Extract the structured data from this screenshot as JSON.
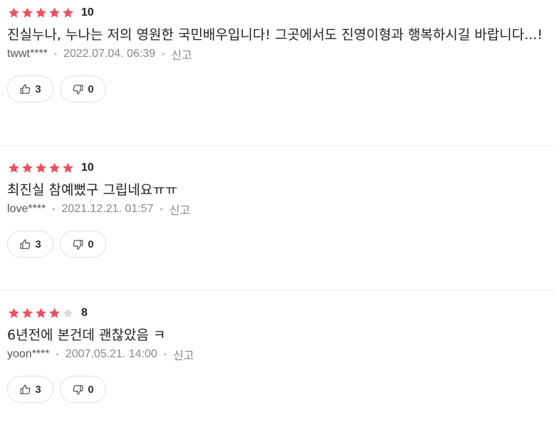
{
  "colors": {
    "star_filled": "#f04e5b",
    "star_empty": "#dcdcdc",
    "meta_text": "#888888",
    "divider": "#eceef1"
  },
  "reviews": [
    {
      "rating": 5,
      "score": "10",
      "text": "진실누나, 누나는 저의 영원한 국민배우입니다! 그곳에서도 진영이형과 행복하시길 바랍니다...!",
      "user": "twwt****",
      "date": "2022.07.04. 06:39",
      "report_label": "신고",
      "likes": "3",
      "dislikes": "0"
    },
    {
      "rating": 5,
      "score": "10",
      "text": "최진실 참예뻤구 그립네요ㅠㅠ",
      "user": "love****",
      "date": "2021.12.21. 01:57",
      "report_label": "신고",
      "likes": "3",
      "dislikes": "0"
    },
    {
      "rating": 4,
      "score": "8",
      "text": "6년전에 본건데 괜찮았음 ㅋ",
      "user": "yoon****",
      "date": "2007.05.21. 14:00",
      "report_label": "신고",
      "likes": "3",
      "dislikes": "0"
    }
  ]
}
